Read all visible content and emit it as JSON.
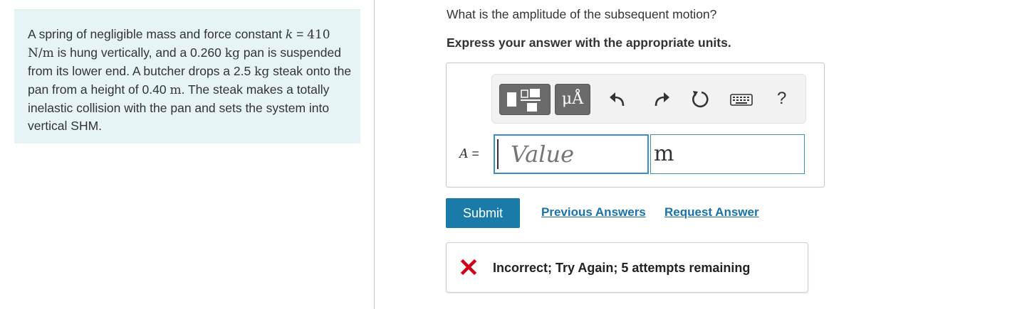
{
  "problem": {
    "parts": [
      "A spring of negligible mass and force constant ",
      "k",
      " = ",
      "410 N/m",
      " is hung vertically, and a 0.260 ",
      "kg",
      " pan is suspended from its lower end. A butcher drops a 2.5 ",
      "kg",
      " steak onto the pan from a height of 0.40 ",
      "m",
      ". The steak makes a totally inelastic collision with the pan and sets the system into vertical SHM."
    ]
  },
  "question": {
    "text": "What is the amplitude of the subsequent motion?",
    "instruction": "Express your answer with the appropriate units."
  },
  "toolbar": {
    "units_label": "μÅ",
    "help_label": "?",
    "icons": [
      "templates-icon",
      "units-icon",
      "undo-icon",
      "redo-icon",
      "reset-icon",
      "keyboard-icon",
      "help-icon"
    ]
  },
  "answer": {
    "variable": "A",
    "equals": "=",
    "value": "",
    "value_placeholder": "Value",
    "unit": "m"
  },
  "actions": {
    "submit_label": "Submit",
    "previous_answers_label": "Previous Answers",
    "request_answer_label": "Request Answer"
  },
  "feedback": {
    "message": "Incorrect; Try Again; 5 attempts remaining",
    "icon": "x-icon",
    "icon_color": "#d0021b"
  },
  "colors": {
    "problem_bg": "#e6f4f6",
    "accent": "#1a7aa8",
    "input_border": "#3c8fc0"
  }
}
